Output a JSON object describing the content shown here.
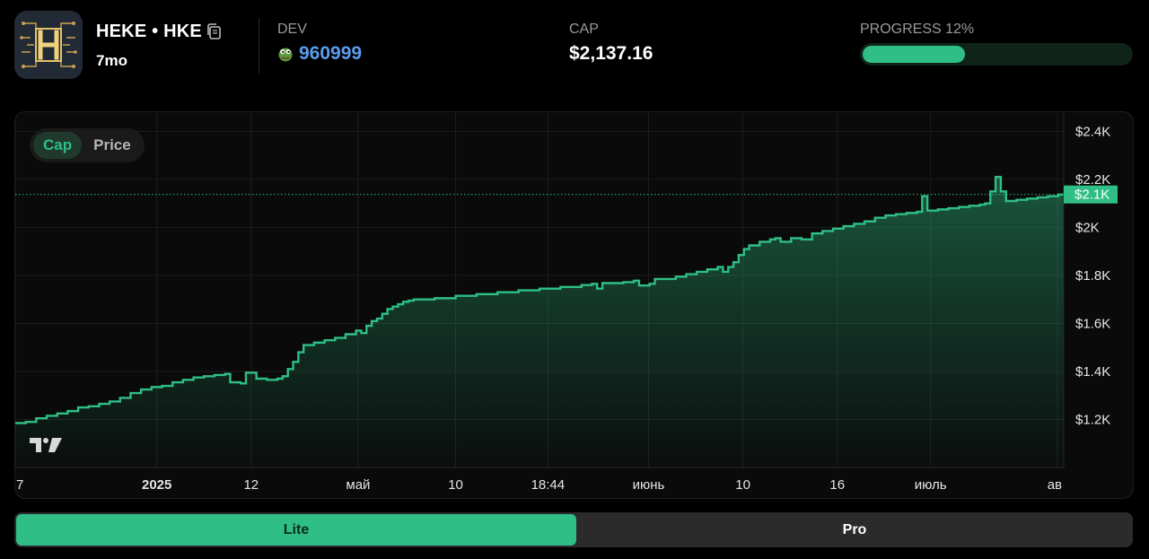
{
  "token": {
    "name": "HEKE • HKE",
    "age": "7mo"
  },
  "stats": {
    "dev_label": "DEV",
    "dev_value": "960999",
    "cap_label": "CAP",
    "cap_value": "$2,137.16",
    "progress_label": "PROGRESS 12%",
    "progress_percent": 12
  },
  "toggle": {
    "cap": "Cap",
    "price": "Price"
  },
  "modes": {
    "lite": "Lite",
    "pro": "Pro"
  },
  "colors": {
    "accent": "#2fbf86",
    "dev_link": "#5b9ded",
    "background": "#000000"
  },
  "chart_data": {
    "type": "area",
    "ylim": [
      1000,
      2480
    ],
    "y_ticks": [
      {
        "value": 1200,
        "label": "$1.2K"
      },
      {
        "value": 1400,
        "label": "$1.4K"
      },
      {
        "value": 1600,
        "label": "$1.6K"
      },
      {
        "value": 1800,
        "label": "$1.8K"
      },
      {
        "value": 2000,
        "label": "$2K"
      },
      {
        "value": 2200,
        "label": "$2.2K"
      },
      {
        "value": 2400,
        "label": "$2.4K"
      }
    ],
    "current_value": 2137.16,
    "current_label": "$2.1K",
    "x_ticks": [
      {
        "pos": 0.0,
        "label": "7",
        "bold": false
      },
      {
        "pos": 0.135,
        "label": "2025",
        "bold": true
      },
      {
        "pos": 0.225,
        "label": "12",
        "bold": false
      },
      {
        "pos": 0.327,
        "label": "май",
        "bold": false
      },
      {
        "pos": 0.42,
        "label": "10",
        "bold": false
      },
      {
        "pos": 0.508,
        "label": "18:44",
        "bold": false
      },
      {
        "pos": 0.604,
        "label": "июнь",
        "bold": false
      },
      {
        "pos": 0.694,
        "label": "10",
        "bold": false
      },
      {
        "pos": 0.784,
        "label": "16",
        "bold": false
      },
      {
        "pos": 0.873,
        "label": "июль",
        "bold": false
      },
      {
        "pos": 0.994,
        "label": "ав",
        "bold": false
      }
    ],
    "series": [
      {
        "values": [
          [
            0.0,
            1185
          ],
          [
            0.01,
            1190
          ],
          [
            0.02,
            1205
          ],
          [
            0.03,
            1215
          ],
          [
            0.04,
            1225
          ],
          [
            0.05,
            1235
          ],
          [
            0.06,
            1250
          ],
          [
            0.07,
            1255
          ],
          [
            0.08,
            1265
          ],
          [
            0.09,
            1275
          ],
          [
            0.1,
            1290
          ],
          [
            0.11,
            1310
          ],
          [
            0.12,
            1325
          ],
          [
            0.13,
            1335
          ],
          [
            0.14,
            1340
          ],
          [
            0.15,
            1355
          ],
          [
            0.16,
            1365
          ],
          [
            0.17,
            1375
          ],
          [
            0.18,
            1380
          ],
          [
            0.19,
            1385
          ],
          [
            0.2,
            1390
          ],
          [
            0.205,
            1355
          ],
          [
            0.215,
            1350
          ],
          [
            0.22,
            1395
          ],
          [
            0.23,
            1370
          ],
          [
            0.24,
            1365
          ],
          [
            0.25,
            1370
          ],
          [
            0.255,
            1380
          ],
          [
            0.26,
            1410
          ],
          [
            0.265,
            1440
          ],
          [
            0.27,
            1480
          ],
          [
            0.275,
            1510
          ],
          [
            0.285,
            1520
          ],
          [
            0.295,
            1530
          ],
          [
            0.305,
            1540
          ],
          [
            0.315,
            1555
          ],
          [
            0.325,
            1570
          ],
          [
            0.33,
            1560
          ],
          [
            0.335,
            1590
          ],
          [
            0.34,
            1610
          ],
          [
            0.345,
            1620
          ],
          [
            0.35,
            1640
          ],
          [
            0.355,
            1660
          ],
          [
            0.36,
            1670
          ],
          [
            0.365,
            1680
          ],
          [
            0.37,
            1690
          ],
          [
            0.375,
            1695
          ],
          [
            0.38,
            1700
          ],
          [
            0.4,
            1705
          ],
          [
            0.42,
            1715
          ],
          [
            0.44,
            1722
          ],
          [
            0.46,
            1730
          ],
          [
            0.48,
            1738
          ],
          [
            0.5,
            1745
          ],
          [
            0.52,
            1752
          ],
          [
            0.54,
            1760
          ],
          [
            0.55,
            1765
          ],
          [
            0.555,
            1745
          ],
          [
            0.56,
            1768
          ],
          [
            0.58,
            1772
          ],
          [
            0.59,
            1778
          ],
          [
            0.595,
            1758
          ],
          [
            0.605,
            1765
          ],
          [
            0.61,
            1785
          ],
          [
            0.63,
            1795
          ],
          [
            0.64,
            1805
          ],
          [
            0.65,
            1815
          ],
          [
            0.66,
            1825
          ],
          [
            0.67,
            1835
          ],
          [
            0.675,
            1815
          ],
          [
            0.68,
            1835
          ],
          [
            0.685,
            1855
          ],
          [
            0.69,
            1885
          ],
          [
            0.695,
            1910
          ],
          [
            0.7,
            1925
          ],
          [
            0.71,
            1940
          ],
          [
            0.72,
            1950
          ],
          [
            0.725,
            1955
          ],
          [
            0.73,
            1940
          ],
          [
            0.74,
            1955
          ],
          [
            0.75,
            1950
          ],
          [
            0.76,
            1975
          ],
          [
            0.77,
            1985
          ],
          [
            0.78,
            1995
          ],
          [
            0.79,
            2005
          ],
          [
            0.8,
            2015
          ],
          [
            0.81,
            2025
          ],
          [
            0.82,
            2040
          ],
          [
            0.83,
            2050
          ],
          [
            0.84,
            2055
          ],
          [
            0.85,
            2060
          ],
          [
            0.86,
            2065
          ],
          [
            0.865,
            2130
          ],
          [
            0.87,
            2070
          ],
          [
            0.88,
            2075
          ],
          [
            0.89,
            2080
          ],
          [
            0.9,
            2085
          ],
          [
            0.91,
            2090
          ],
          [
            0.92,
            2095
          ],
          [
            0.925,
            2100
          ],
          [
            0.93,
            2150
          ],
          [
            0.935,
            2210
          ],
          [
            0.94,
            2150
          ],
          [
            0.945,
            2110
          ],
          [
            0.955,
            2115
          ],
          [
            0.965,
            2120
          ],
          [
            0.975,
            2125
          ],
          [
            0.985,
            2130
          ],
          [
            0.995,
            2137
          ],
          [
            1.0,
            2140
          ]
        ]
      }
    ]
  }
}
